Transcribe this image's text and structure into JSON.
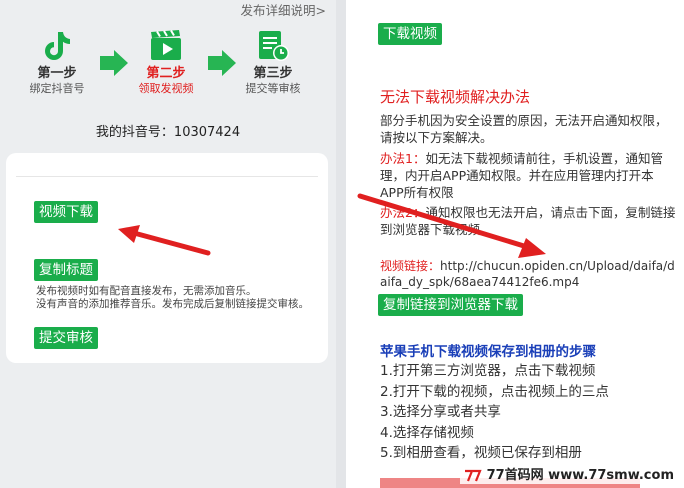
{
  "left": {
    "help_link": "发布详细说明>",
    "steps": [
      {
        "title": "第一步",
        "subtitle": "绑定抖音号",
        "icon": "tiktok-icon"
      },
      {
        "title": "第二步",
        "subtitle": "领取发视频",
        "icon": "video-clapper-icon"
      },
      {
        "title": "第三步",
        "subtitle": "提交等审核",
        "icon": "review-icon"
      }
    ],
    "douyin_id_label": "我的抖音号：",
    "douyin_id_value": "10307424",
    "buttons": {
      "download": "视频下载",
      "copy_title": "复制标题",
      "submit": "提交审核"
    },
    "note_line1": "发布视频时如有配音直接发布，无需添加音乐。",
    "note_line2": "没有声音的添加推荐音乐。发布完成后复制链接提交审核。"
  },
  "right": {
    "top_button": "下载视频",
    "solution_title": "无法下载视频解决办法",
    "intro": "部分手机因为安全设置的原因，无法开启通知权限，请按以下方案解决。",
    "method1_label": "办法1：",
    "method1_text": "如无法下载视频请前往，手机设置，通知管理，内开启APP通知权限。并在应用管理内打开本APP所有权限",
    "method2_label": "办法2：",
    "method2_text": "通知权限也无法开启，请点击下面，复制链接到浏览器下载视频",
    "link_label": "视频链接：",
    "link_url": "http://chucun.opiden.cn/Upload/daifa/daifa_dy_spk/68aea74412fe6.mp4",
    "copy_link_button": "复制链接到浏览器下载",
    "apple_title": "苹果手机下载视频保存到相册的步骤",
    "apple_steps": [
      "1.打开第三方浏览器，点击下载视频",
      "2.打开下载的视频，点击视频上的三点",
      "3.选择分享或者共享",
      "4.选择存储视频",
      "5.到相册查看，视频已保存到相册"
    ]
  },
  "watermark": "77首码网 www.77smw.com",
  "colors": {
    "green": "#1aad4b",
    "red": "#e02020",
    "blue": "#1a3fb8",
    "panel_bg": "#eceef0"
  }
}
